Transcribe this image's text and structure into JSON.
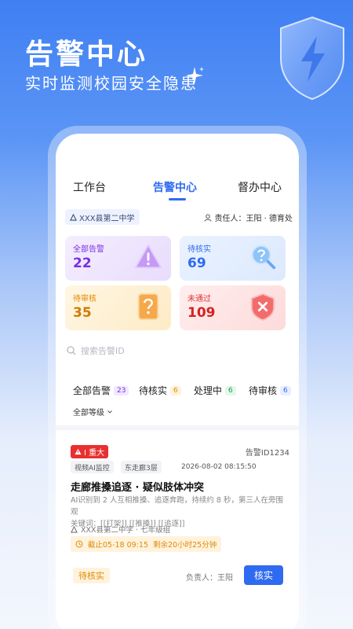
{
  "hero": {
    "title": "告警中心",
    "subtitle": "实时监测校园安全隐患"
  },
  "tabs": [
    {
      "label": "工作台"
    },
    {
      "label": "告警中心",
      "active": true
    },
    {
      "label": "督办中心"
    }
  ],
  "school": "XXX县第二中学",
  "owner": "责任人：王阳 · 德育处",
  "stats": [
    {
      "label": "全部告警",
      "value": "22",
      "icon": "warning-icon",
      "color": "#7a2fe0"
    },
    {
      "label": "待核实",
      "value": "69",
      "icon": "magnifier-question-icon",
      "color": "#2f6bf0"
    },
    {
      "label": "待审核",
      "value": "35",
      "icon": "question-doc-icon",
      "color": "#e08a00"
    },
    {
      "label": "未通过",
      "value": "109",
      "icon": "shield-x-icon",
      "color": "#e03434"
    }
  ],
  "search": {
    "placeholder": "搜索告警ID"
  },
  "filter_tabs": [
    {
      "label": "全部告警",
      "count": "23"
    },
    {
      "label": "待核实",
      "count": "6"
    },
    {
      "label": "处理中",
      "count": "6"
    },
    {
      "label": "待审核",
      "count": "6"
    }
  ],
  "level_filter": "全部等级",
  "alert": {
    "severity": "I 重大",
    "id": "告警ID1234",
    "tags": [
      "视频AI监控",
      "东走廊3层"
    ],
    "time": "2026-08-02 08:15:50",
    "title": "走廊推搡追逐 · 疑似肢体冲突",
    "desc_line1": "AI识别到 2 人互相推搡、追逐奔跑，持续约 8 秒，第三人在旁围观",
    "desc_line2": "关键词：[[打架]] [[推搡]] [[追逐]]",
    "school": "XXX县第二中学 · 七年级组",
    "deadline_date": "截止05-18  09:15",
    "deadline_remaining": "剩余20小时25分钟",
    "status": "待核实",
    "assignee": "负责人：王阳",
    "action": "核实"
  }
}
